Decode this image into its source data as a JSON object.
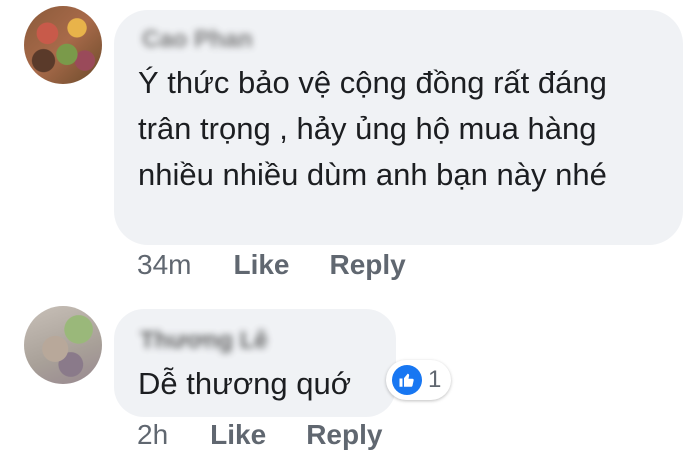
{
  "comments": [
    {
      "author": "Cao Phan",
      "text": "Ý thức bảo vệ cộng đồng rất đáng\ntrân trọng , hảy ủng hộ mua hàng\nnhiều nhiều dùm anh bạn này nhé",
      "time": "34m",
      "like_label": "Like",
      "reply_label": "Reply"
    },
    {
      "author": "Thương Lê",
      "text": "Dễ thương quớ",
      "time": "2h",
      "like_label": "Like",
      "reply_label": "Reply",
      "reaction_count": "1",
      "reaction_icon": "thumbs-up-icon"
    }
  ],
  "colors": {
    "bubble": "#f0f2f5",
    "like_blue": "#1877f2",
    "meta_text": "#606770",
    "body_text": "#1c1e21"
  }
}
